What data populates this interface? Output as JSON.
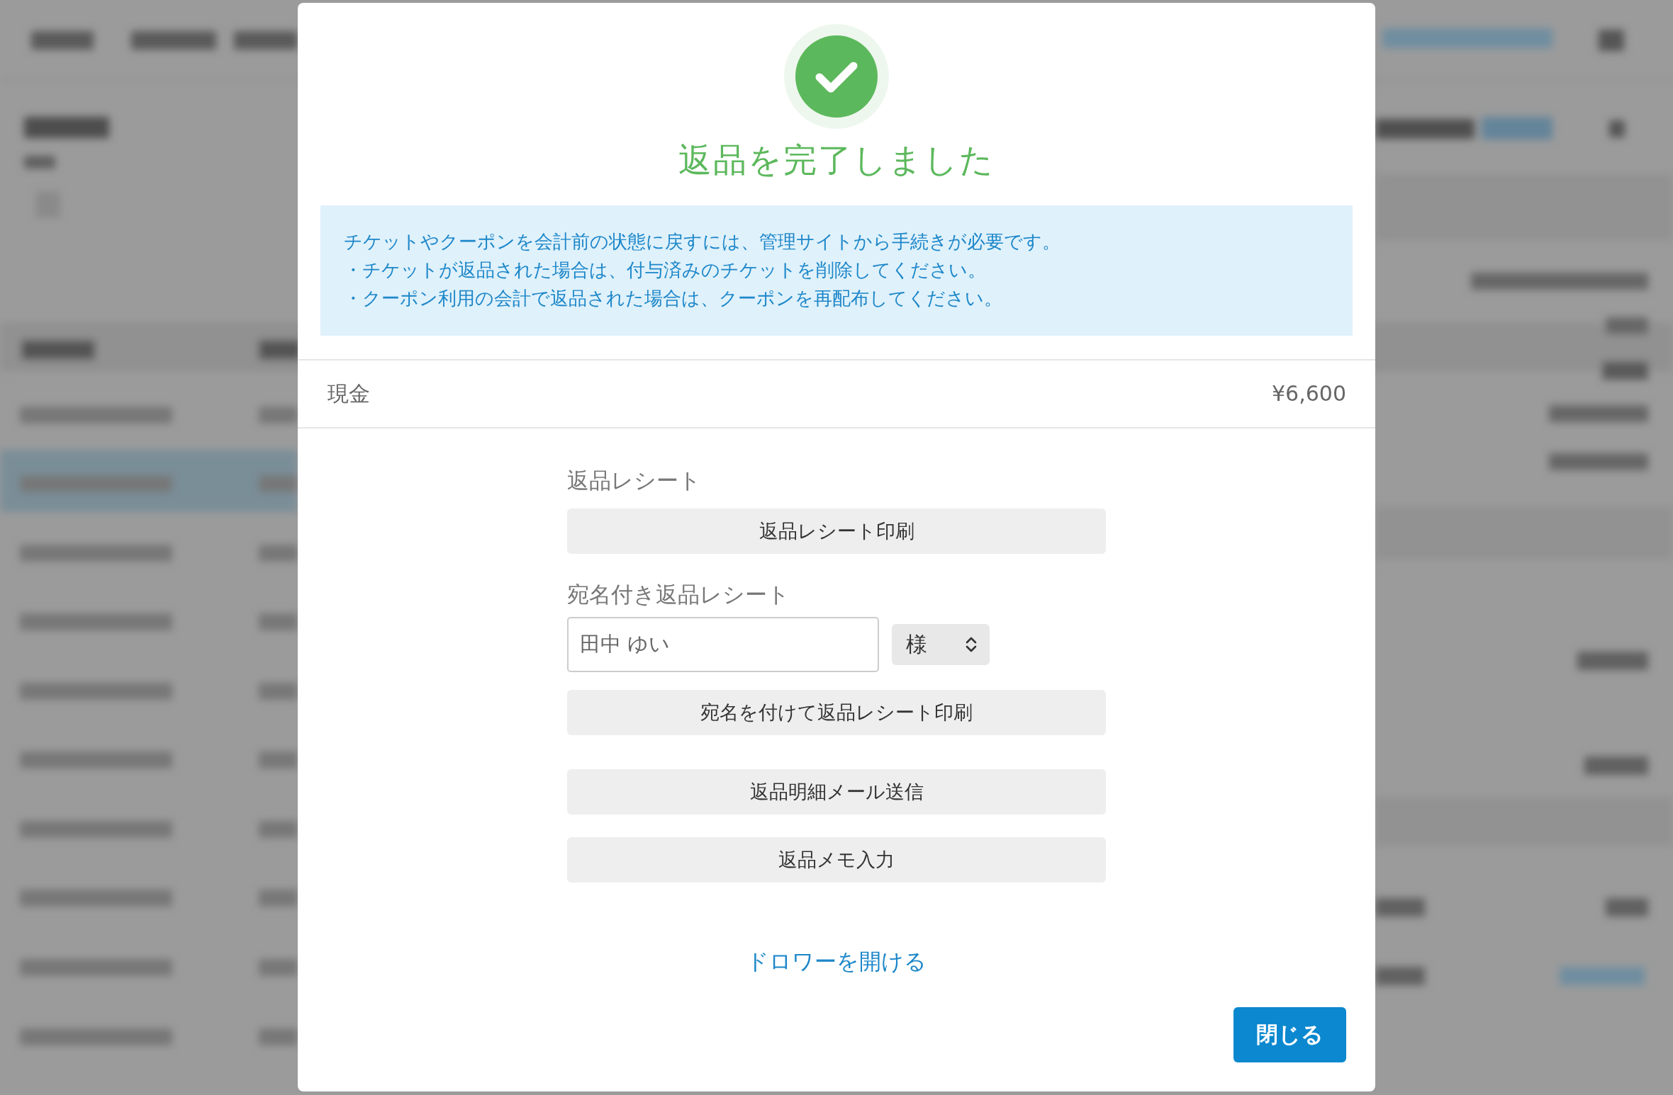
{
  "dialog": {
    "status_title": "返品を完了しました",
    "notice_lines": [
      "チケットやクーポンを会計前の状態に戻すには、管理サイトから手続きが必要です。",
      "・チケットが返品された場合は、付与済みのチケットを削除してください。",
      "・クーポン利用の会計で返品された場合は、クーポンを再配布してください。"
    ],
    "payment": {
      "method": "現金",
      "amount": "¥6,600"
    },
    "receipt_section": {
      "label": "返品レシート",
      "button": "返品レシート印刷"
    },
    "addressed_receipt": {
      "label": "宛名付き返品レシート",
      "name_field": {
        "value": "田中 ゆい"
      },
      "honorific_select": {
        "value": "様"
      },
      "button": "宛名を付けて返品レシート印刷"
    },
    "actions": [
      "返品明細メール送信",
      "返品メモ入力"
    ],
    "drawer_link": "ドロワーを開ける",
    "close_button": "閉じる"
  }
}
